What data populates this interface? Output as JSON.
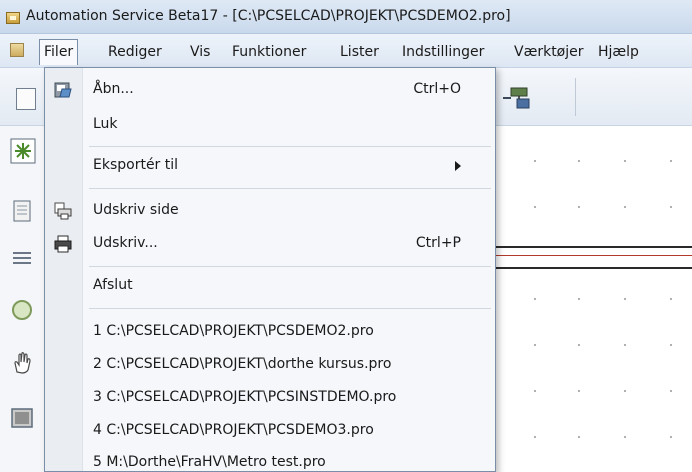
{
  "window": {
    "title": "Automation Service Beta17 - [C:\\PCSELCAD\\PROJEKT\\PCSDEMO2.pro]"
  },
  "menubar": {
    "items": [
      "Filer",
      "Rediger",
      "Vis",
      "Funktioner",
      "Lister",
      "Indstillinger",
      "Værktøjer",
      "Hjælp"
    ],
    "active": "Filer"
  },
  "file_menu": {
    "open": {
      "label": "Åbn...",
      "shortcut": "Ctrl+O",
      "icon": "open-folder-icon"
    },
    "close": {
      "label": "Luk"
    },
    "export": {
      "label": "Eksportér til",
      "has_submenu": true
    },
    "print_page": {
      "label": "Udskriv side",
      "icon": "print-page-icon"
    },
    "print": {
      "label": "Udskriv...",
      "shortcut": "Ctrl+P",
      "icon": "printer-icon"
    },
    "exit": {
      "label": "Afslut"
    },
    "recent_files": [
      "1 C:\\PCSELCAD\\PROJEKT\\PCSDEMO2.pro",
      "2 C:\\PCSELCAD\\PROJEKT\\dorthe kursus.pro",
      "3 C:\\PCSELCAD\\PROJEKT\\PCSINSTDEMO.pro",
      "4 C:\\PCSELCAD\\PROJEKT\\PCSDEMO3.pro",
      "5 M:\\Dorthe\\FraHV\\Metro test.pro"
    ]
  },
  "toolbar": {
    "icons": [
      "document-icon",
      "flowchart-icon"
    ]
  },
  "palette": {
    "tools": [
      "star-tool-icon",
      "page-tool-icon",
      "lines-tool-icon",
      "circle-tool-icon",
      "hand-tool-icon",
      "image-tool-icon"
    ]
  },
  "colors": {
    "menu_background": "#f5f7fa",
    "menu_border": "#7b8ea8",
    "titlebar": "#c9d9ec"
  }
}
